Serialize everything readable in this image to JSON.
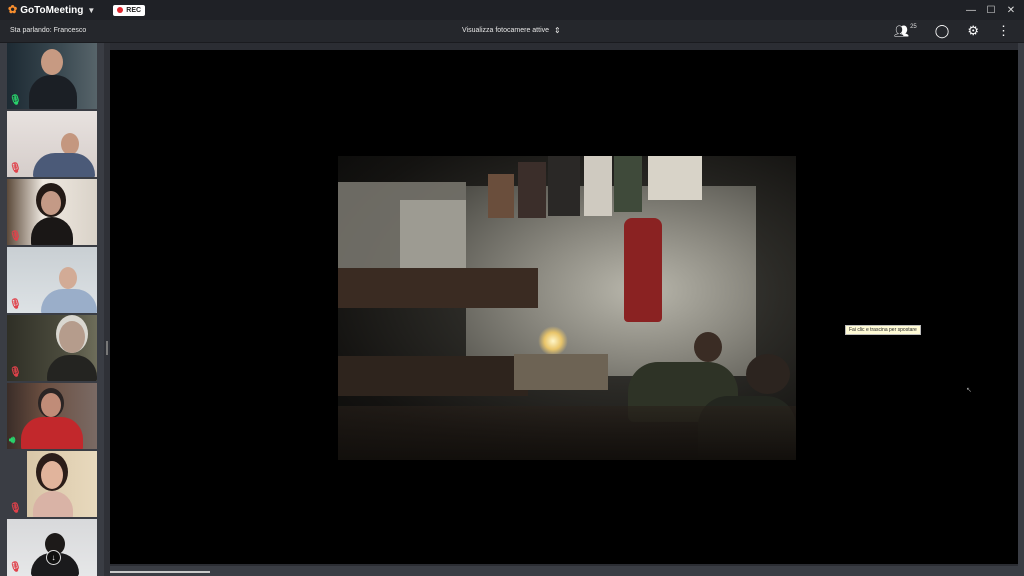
{
  "app": {
    "brand": "GoToMeeting",
    "rec_label": "REC",
    "window_controls": [
      "minimize",
      "maximize",
      "close"
    ]
  },
  "toolbar": {
    "speaking": "Sta parlando: Francesco",
    "camera_view": "Visualizza fotocamere attive",
    "participants_count": "25"
  },
  "participants": [
    {
      "mic": "on"
    },
    {
      "mic": "off"
    },
    {
      "mic": "off"
    },
    {
      "mic": "off"
    },
    {
      "mic": "off"
    },
    {
      "mic": "speaking"
    },
    {
      "mic": "off"
    },
    {
      "mic": "off"
    }
  ],
  "stage": {
    "tooltip": "Fai clic e trascina per spostare"
  },
  "colors": {
    "accent": "#f68d2e",
    "rec": "#e0262d",
    "mic_on": "#29d36b",
    "mic_off": "#e0414a"
  }
}
